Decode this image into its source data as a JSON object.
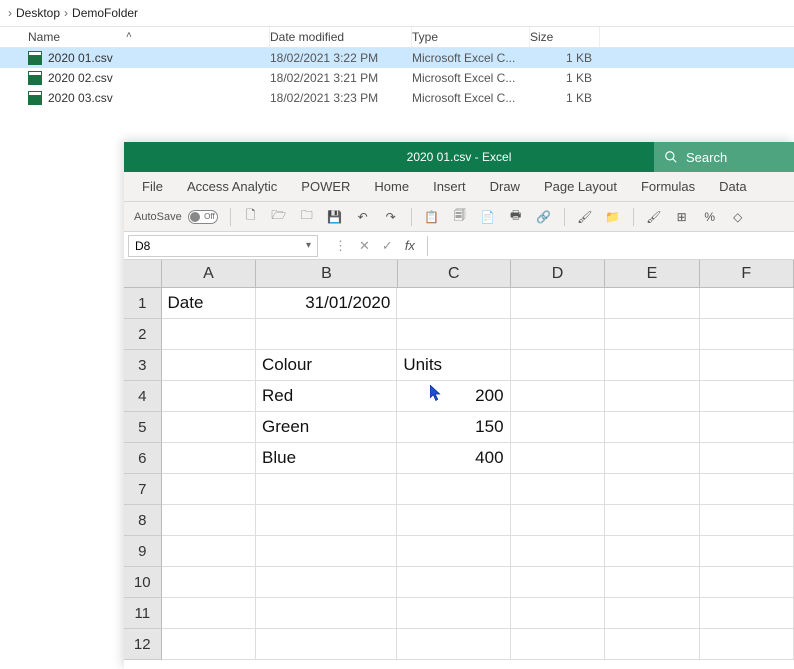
{
  "breadcrumb": {
    "a": "Desktop",
    "b": "DemoFolder"
  },
  "columns": {
    "name": "Name",
    "date": "Date modified",
    "type": "Type",
    "size": "Size"
  },
  "files": [
    {
      "name": "2020 01.csv",
      "date": "18/02/2021 3:22 PM",
      "type": "Microsoft Excel C...",
      "size": "1 KB"
    },
    {
      "name": "2020 02.csv",
      "date": "18/02/2021 3:21 PM",
      "type": "Microsoft Excel C...",
      "size": "1 KB"
    },
    {
      "name": "2020 03.csv",
      "date": "18/02/2021 3:23 PM",
      "type": "Microsoft Excel C...",
      "size": "1 KB"
    }
  ],
  "excel": {
    "title": "2020 01.csv  -  Excel",
    "search": "Search",
    "tabs": {
      "file": "File",
      "access": "Access Analytic",
      "power": "POWER",
      "home": "Home",
      "insert": "Insert",
      "draw": "Draw",
      "page": "Page Layout",
      "formulas": "Formulas",
      "data": "Data"
    },
    "autosave": "AutoSave",
    "off": "Off",
    "namebox": "D8",
    "cols": {
      "A": "A",
      "B": "B",
      "C": "C",
      "D": "D",
      "E": "E",
      "F": "F"
    },
    "rows": [
      "1",
      "2",
      "3",
      "4",
      "5",
      "6",
      "7",
      "8",
      "9",
      "10",
      "11",
      "12"
    ],
    "cells": {
      "A1": "Date",
      "B1": "31/01/2020",
      "B3": "Colour",
      "C3": "Units",
      "B4": "Red",
      "C4": "200",
      "B5": "Green",
      "C5": "150",
      "B6": "Blue",
      "C6": "400"
    }
  },
  "chart_data": {
    "type": "table",
    "title": "2020 01.csv",
    "meta": {
      "Date": "31/01/2020"
    },
    "columns": [
      "Colour",
      "Units"
    ],
    "rows": [
      [
        "Red",
        200
      ],
      [
        "Green",
        150
      ],
      [
        "Blue",
        400
      ]
    ]
  }
}
